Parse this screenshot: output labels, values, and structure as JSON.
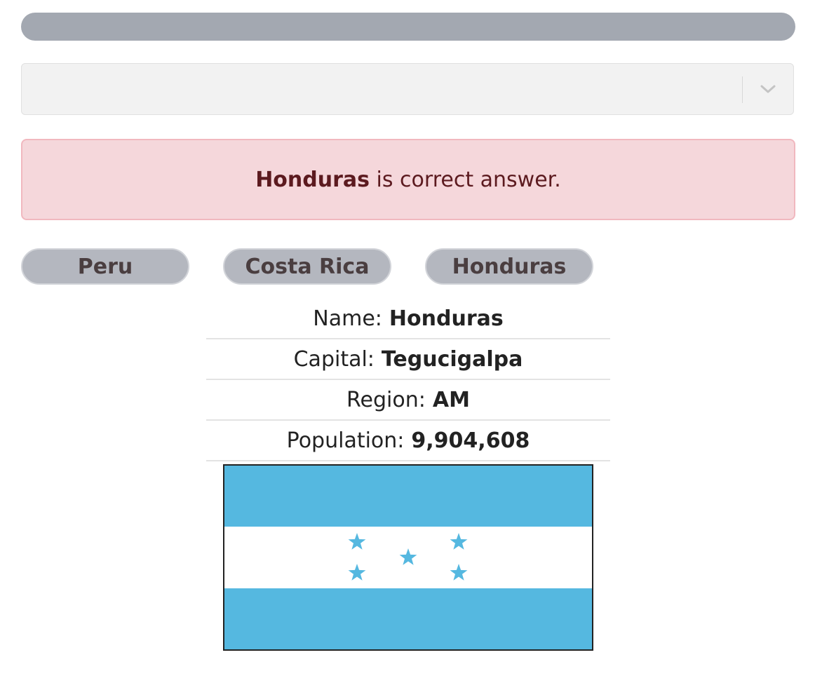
{
  "progress": {
    "value_percent": 100,
    "color": "#a3a8b1"
  },
  "select": {
    "value": "",
    "icon": "chevron-down-icon"
  },
  "alert": {
    "answer": "Honduras",
    "message": " is correct answer.",
    "color": "#f5d7db"
  },
  "options": [
    {
      "label": "Peru"
    },
    {
      "label": "Costa Rica"
    },
    {
      "label": "Honduras"
    }
  ],
  "country": {
    "name_label": "Name:",
    "name": "Honduras",
    "capital_label": "Capital:",
    "capital": "Tegucigalpa",
    "region_label": "Region:",
    "region": "AM",
    "population_label": "Population:",
    "population": "9,904,608"
  },
  "flag": {
    "country": "Honduras",
    "blue": "#55b8e0",
    "white": "#ffffff"
  }
}
